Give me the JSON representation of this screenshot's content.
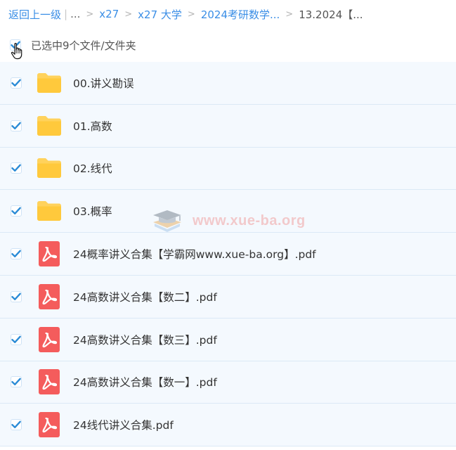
{
  "breadcrumb": {
    "back": "返回上一级",
    "pipe": "|",
    "ellipsis": "...",
    "items": [
      "x27",
      "x27 大学",
      "2024考研数学...",
      "13.2024【..."
    ],
    "separator": ">"
  },
  "selection": {
    "label": "已选中9个文件/文件夹"
  },
  "files": [
    {
      "name": "00.讲义勘误",
      "type": "folder"
    },
    {
      "name": "01.高数",
      "type": "folder"
    },
    {
      "name": "02.线代",
      "type": "folder"
    },
    {
      "name": "03.概率",
      "type": "folder"
    },
    {
      "name": "24概率讲义合集【学霸网www.xue-ba.org】.pdf",
      "type": "pdf"
    },
    {
      "name": "24高数讲义合集【数二】.pdf",
      "type": "pdf"
    },
    {
      "name": "24高数讲义合集【数三】.pdf",
      "type": "pdf"
    },
    {
      "name": "24高数讲义合集【数一】.pdf",
      "type": "pdf"
    },
    {
      "name": "24线代讲义合集.pdf",
      "type": "pdf"
    }
  ],
  "watermark": {
    "text": "www.xue-ba.org",
    "icon": "graduation-cap-book-icon"
  },
  "colors": {
    "link": "#3a8ee6",
    "checkmark": "#2a8bd6",
    "row_bg": "#f4f9fe",
    "folder": "#ffd25c",
    "pdf": "#f45c5c"
  }
}
